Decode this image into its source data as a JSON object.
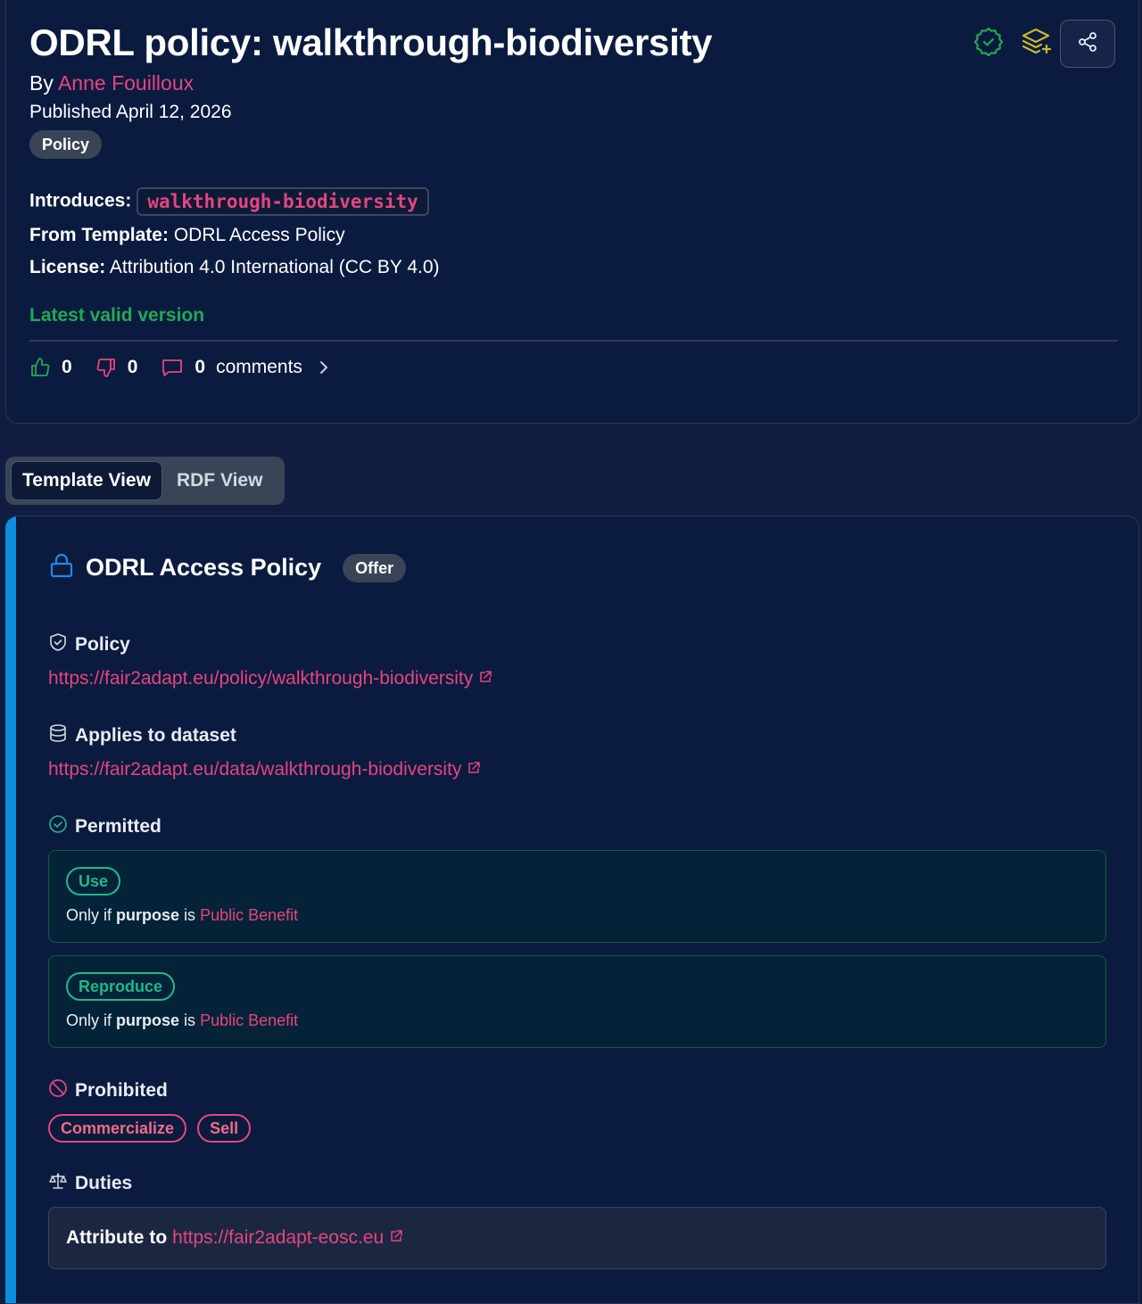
{
  "header": {
    "title": "ODRL policy: walkthrough-biodiversity",
    "by_prefix": "By",
    "author": "Anne Fouilloux",
    "published": "Published April 12, 2026",
    "type_tag": "Policy",
    "introduces_label": "Introduces:",
    "introduces_value": "walkthrough-biodiversity",
    "template_label": "From Template:",
    "template_value": "ODRL Access Policy",
    "license_label": "License:",
    "license_value": "Attribution 4.0 International (CC BY 4.0)",
    "version_status": "Latest valid version",
    "likes": "0",
    "dislikes": "0",
    "comments_count": "0",
    "comments_label": "comments",
    "icons": [
      "verified-badge-icon",
      "add-layer-icon",
      "share-icon"
    ]
  },
  "tabs": [
    {
      "label": "Template View",
      "active": true
    },
    {
      "label": "RDF View",
      "active": false
    }
  ],
  "policy": {
    "name": "ODRL Access Policy",
    "kind": "Offer",
    "policy_label": "Policy",
    "policy_url": "https://fair2adapt.eu/policy/walkthrough-biodiversity",
    "dataset_label": "Applies to dataset",
    "dataset_url": "https://fair2adapt.eu/data/walkthrough-biodiversity",
    "permitted_label": "Permitted",
    "permissions": [
      {
        "action": "Use",
        "cond_prefix": "Only if",
        "cond_key": "purpose",
        "cond_op": "is",
        "cond_value": "Public Benefit"
      },
      {
        "action": "Reproduce",
        "cond_prefix": "Only if",
        "cond_key": "purpose",
        "cond_op": "is",
        "cond_value": "Public Benefit"
      }
    ],
    "prohibited_label": "Prohibited",
    "prohibitions": [
      "Commercialize",
      "Sell"
    ],
    "duties_label": "Duties",
    "duty_text": "Attribute to",
    "duty_url": "https://fair2adapt-eosc.eu"
  },
  "colors": {
    "background": "#101d40",
    "card": "#0a1b3f",
    "accent_pink": "#e5457e",
    "valid_green": "#22a955",
    "permit_teal": "#1fb98a",
    "accent_blue": "#0d8ee0"
  }
}
